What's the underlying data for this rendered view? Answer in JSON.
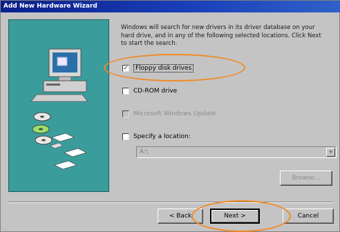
{
  "window": {
    "title": "Add New Hardware Wizard"
  },
  "description": "Windows will search for new drivers in its driver database on your hard drive, and in any of the following selected locations. Click Next to start the search.",
  "options": [
    {
      "label": "Floppy disk drives",
      "checked": true,
      "enabled": true
    },
    {
      "label": "CD-ROM drive",
      "checked": false,
      "enabled": true
    },
    {
      "label": "Microsoft Windows Update",
      "checked": false,
      "enabled": false
    },
    {
      "label": "Specify a location:",
      "checked": false,
      "enabled": true
    }
  ],
  "location": {
    "value": "A:\\",
    "browse_label": "Browse..."
  },
  "buttons": {
    "back": "< Back",
    "next": "Next >",
    "cancel": "Cancel"
  },
  "colors": {
    "highlight": "#f08a24",
    "illustration_bg": "#3b9c9c",
    "titlebar": "#0a1f8a"
  },
  "icons": [
    "computer-icon",
    "cd-disc-icon",
    "floppy-disk-icon",
    "arrow-icon"
  ]
}
